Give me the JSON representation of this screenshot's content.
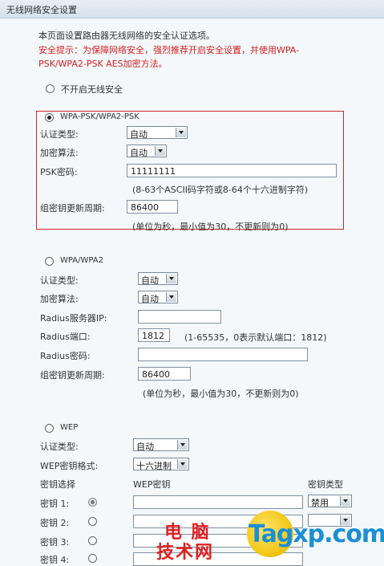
{
  "window_title": "无线网络安全设置",
  "intro": "本页面设置路由器无线网络的安全认证选项。",
  "tip_line1": "安全提示：为保障网络安全，强烈推荐开启安全设置，并使用WPA-",
  "tip_line2": "PSK/WPA2-PSK AES加密方法。",
  "no_security_label": "不开启无线安全",
  "wpa_psk": {
    "title": "WPA-PSK/WPA2-PSK",
    "auth_label": "认证类型:",
    "auth_value": "自动",
    "enc_label": "加密算法:",
    "enc_value": "自动",
    "psk_label": "PSK密码:",
    "psk_value": "11111111",
    "psk_hint": "(8-63个ASCII码字符或8-64个十六进制字符)",
    "rekey_label": "组密钥更新周期:",
    "rekey_value": "86400",
    "rekey_hint": "(单位为秒，最小值为30，不更新则为0)"
  },
  "wpa": {
    "title": "WPA/WPA2",
    "auth_label": "认证类型:",
    "auth_value": "自动",
    "enc_label": "加密算法:",
    "enc_value": "自动",
    "radius_ip_label": "Radius服务器IP:",
    "radius_ip_value": "",
    "radius_port_label": "Radius端口:",
    "radius_port_value": "1812",
    "radius_port_hint": "(1-65535，0表示默认端口：1812)",
    "radius_pwd_label": "Radius密码:",
    "radius_pwd_value": "",
    "rekey_label": "组密钥更新周期:",
    "rekey_value": "86400",
    "rekey_hint": "(单位为秒，最小值为30，不更新则为0)"
  },
  "wep": {
    "title": "WEP",
    "auth_label": "认证类型:",
    "auth_value": "自动",
    "format_label": "WEP密钥格式:",
    "format_value": "十六进制",
    "col_select": "密钥选择",
    "col_key": "WEP密钥",
    "col_type": "密钥类型",
    "keys": [
      {
        "label": "密钥 1:",
        "value": "",
        "type": "禁用"
      },
      {
        "label": "密钥 2:",
        "value": "",
        "type": ""
      },
      {
        "label": "密钥 3:",
        "value": "",
        "type": ""
      },
      {
        "label": "密钥 4:",
        "value": "",
        "type": ""
      }
    ]
  },
  "watermark": {
    "cn_line1": "电 脑",
    "cn_line2": "技术网",
    "site": "Tagxp.com",
    "colors": {
      "red": "#e02020",
      "blue": "#1a8fd6",
      "yellow": "#f3c81a"
    }
  }
}
